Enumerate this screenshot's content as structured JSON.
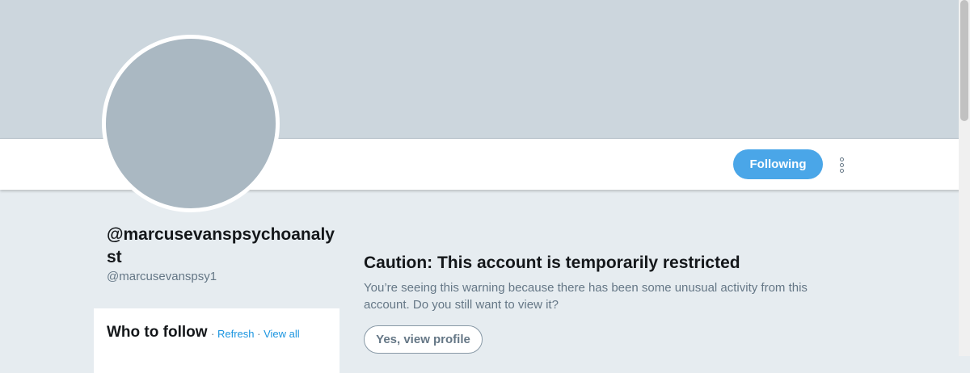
{
  "profile": {
    "screen_name": "@marcusevanspsychoanalyst",
    "handle": "@marcusevanspsy1",
    "follow_button_label": "Following",
    "more_icon": "more-vertical-icon"
  },
  "sidebar": {
    "who_to_follow": {
      "title": "Who to follow",
      "separator": "·",
      "refresh_label": "Refresh",
      "view_all_label": "View all"
    }
  },
  "warning": {
    "title": "Caution: This account is temporarily restricted",
    "message": "You’re seeing this warning because there has been some unusual activity from this account. Do you still want to view it?",
    "button_label": "Yes, view profile"
  },
  "colors": {
    "banner": "#ccd6dd",
    "avatar": "#aab8c2",
    "accent": "#4aa6e8",
    "link": "#1b95e0",
    "page_background": "#e6ecf0"
  }
}
